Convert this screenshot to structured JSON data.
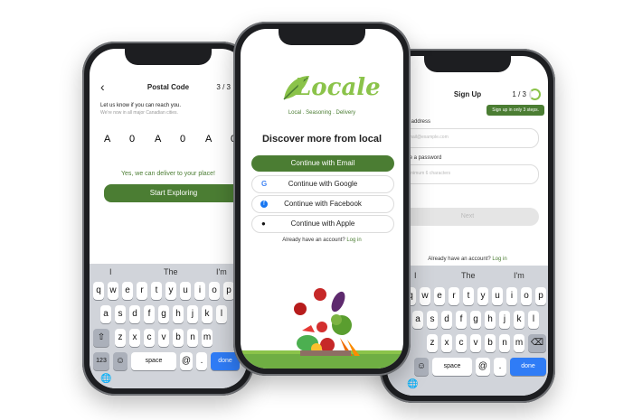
{
  "left": {
    "header": {
      "back_icon": "chevron-left-icon",
      "title": "Postal Code",
      "step": "3 / 3"
    },
    "prompt": "Let us know if you can reach you.",
    "subprompt": "We're now in all major Canadian cities.",
    "code_chars": [
      "A",
      "0",
      "A",
      "0",
      "A",
      "0"
    ],
    "status": "Yes, we can deliver to your place!",
    "cta": "Start Exploring",
    "cta_arrow": "›",
    "suggestions": [
      "I",
      "The",
      "I'm"
    ],
    "keys_row1": [
      "q",
      "w",
      "e",
      "r",
      "t",
      "y",
      "u",
      "i",
      "o",
      "p"
    ],
    "keys_row2": [
      "a",
      "s",
      "d",
      "f",
      "g",
      "h",
      "j",
      "k",
      "l"
    ],
    "keys_row3": [
      "z",
      "x",
      "c",
      "v",
      "b",
      "n",
      "m"
    ],
    "key_numbers": "123",
    "key_space": "space",
    "key_at": "@",
    "key_dot": ".",
    "key_done": "done"
  },
  "center": {
    "logo_text": "Locale",
    "tagline": "Local . Seasoning . Delivery",
    "headline": "Discover more from local",
    "email_btn": "Continue with Email",
    "google_btn": "Continue with Google",
    "facebook_btn": "Continue with Facebook",
    "apple_btn": "Continue with Apple",
    "account_prefix": "Already have an account?",
    "login": "Log in"
  },
  "right": {
    "header": {
      "title": "Sign Up",
      "step": "1 / 3"
    },
    "tooltip": "Sign up in only 3 steps.",
    "email_label": "Email address",
    "email_placeholder": "email@example.com",
    "password_label": "Create a password",
    "password_placeholder": "Minimum 6 characters",
    "next": "Next",
    "account_prefix": "Already have an account?",
    "login": "Log in",
    "suggestions": [
      "I",
      "The",
      "I'm"
    ],
    "keys_row1": [
      "q",
      "w",
      "e",
      "r",
      "t",
      "y",
      "u",
      "i",
      "o",
      "p"
    ],
    "keys_row2": [
      "a",
      "s",
      "d",
      "f",
      "g",
      "h",
      "j",
      "k",
      "l"
    ],
    "keys_row3": [
      "z",
      "x",
      "c",
      "v",
      "b",
      "n",
      "m"
    ],
    "key_space": "space",
    "key_at": "@",
    "key_dot": ".",
    "key_done": "done"
  },
  "colors": {
    "brand_green": "#4b7d33",
    "accent_lime": "#8bc34a",
    "keyboard_bg": "#d1d4da",
    "done_blue": "#2f7cf6"
  }
}
